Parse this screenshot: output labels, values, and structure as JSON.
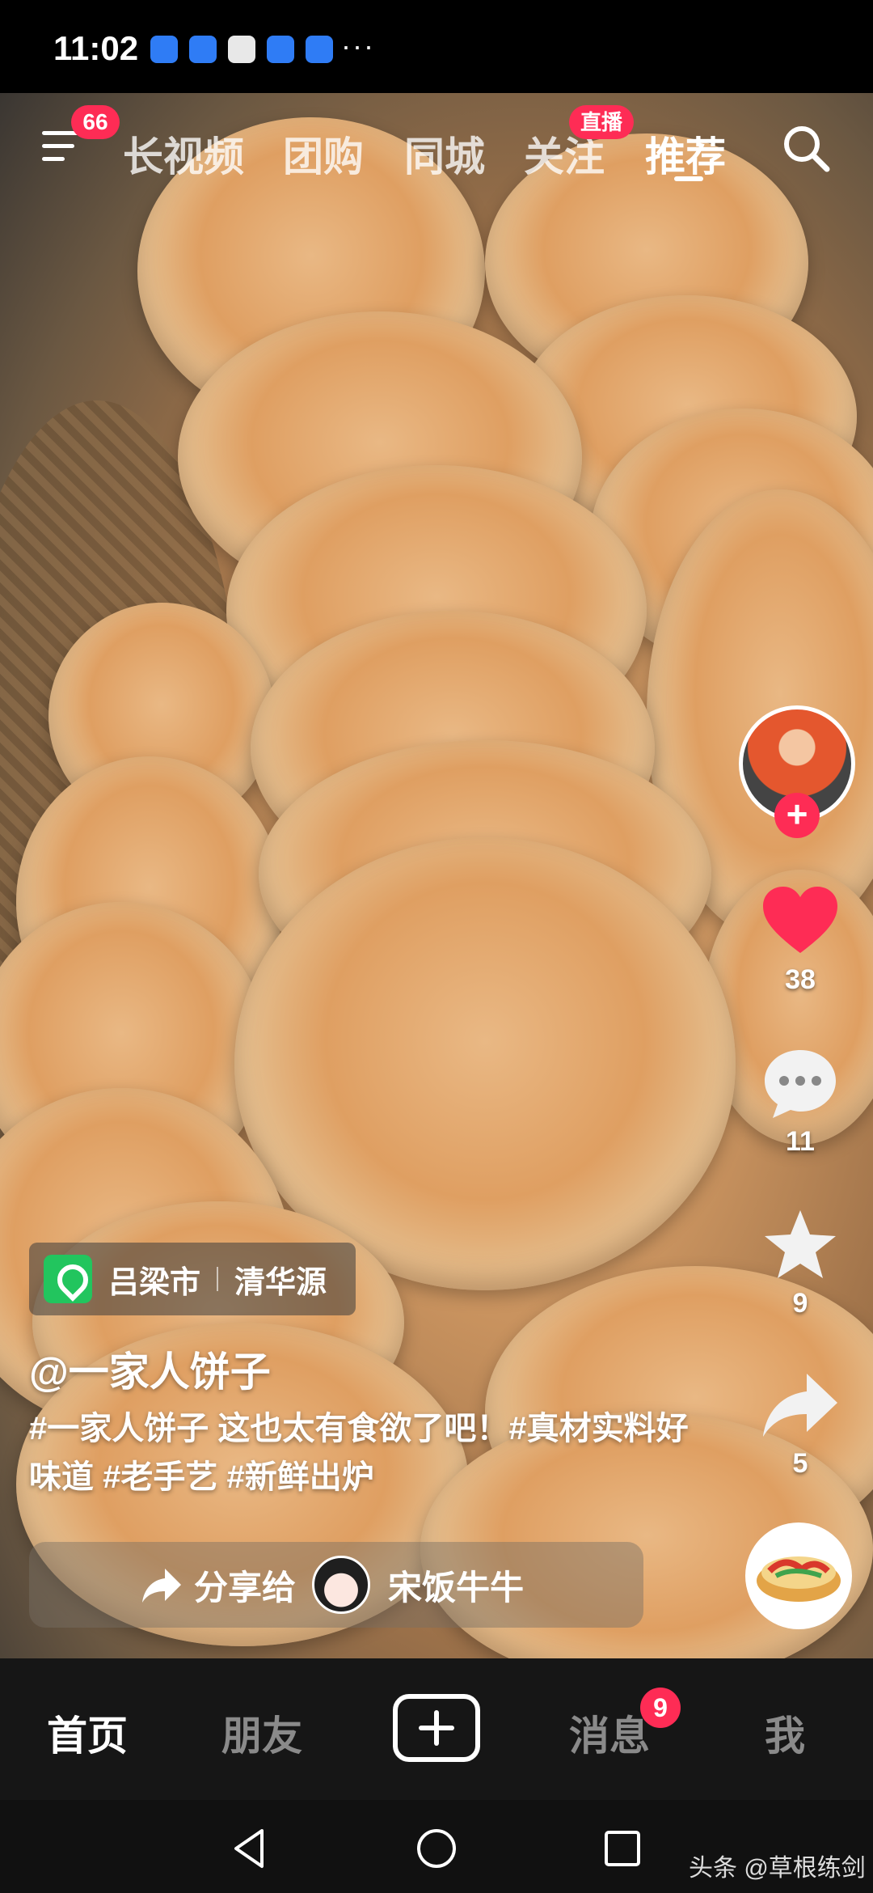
{
  "status_bar": {
    "time": "11:02",
    "more": "···"
  },
  "top_nav": {
    "menu_badge": "66",
    "tabs": [
      "长视频",
      "团购",
      "同城",
      "关注",
      "推荐"
    ],
    "live_badge": "直播"
  },
  "rail": {
    "likes": "38",
    "comments": "11",
    "favorites": "9",
    "shares": "5"
  },
  "location": {
    "city": "吕梁市",
    "place": "清华源"
  },
  "author": "@一家人饼子",
  "description": {
    "tag1": "#一家人饼子",
    "text": " 这也太有食欲了吧！",
    "tag2": "#真材实料好味道",
    "tag3": "#老手艺",
    "tag4": "#新鲜出炉"
  },
  "share": {
    "label": "分享给",
    "user": "宋饭牛牛"
  },
  "bottom_nav": {
    "home": "首页",
    "friends": "朋友",
    "messages": "消息",
    "messages_badge": "9",
    "me": "我"
  },
  "watermark": "头条 @草根练剑",
  "colors": {
    "accent": "#fe2c55",
    "location_pin": "#22c55e"
  }
}
